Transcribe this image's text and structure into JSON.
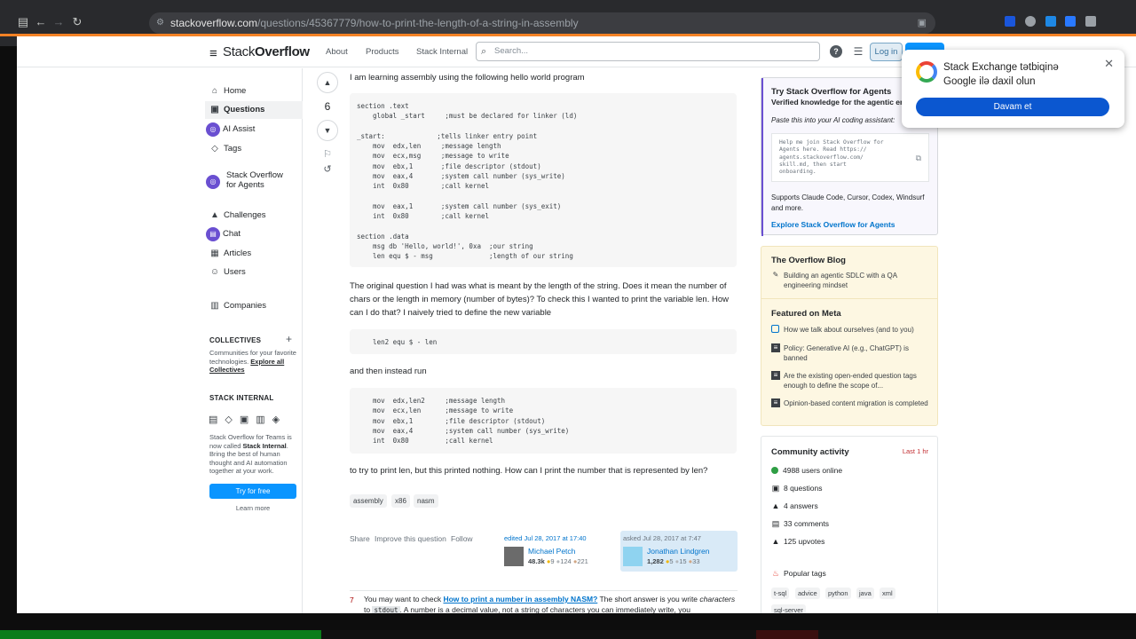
{
  "browser": {
    "url_host": "stackoverflow.com",
    "url_path": "/questions/45367779/how-to-print-the-length-of-a-string-in-assembly"
  },
  "header": {
    "logo_pre": "Stack",
    "logo_bold": "Overflow",
    "nav": [
      "About",
      "Products",
      "Stack Internal"
    ],
    "search_placeholder": "Search...",
    "login": "Log in"
  },
  "sidebar": {
    "items": [
      {
        "label": "Home",
        "icon": "home-icon"
      },
      {
        "label": "Questions",
        "icon": "questions-icon"
      },
      {
        "label": "AI Assist",
        "icon": "ai-assist-icon"
      },
      {
        "label": "Tags",
        "icon": "tag-icon"
      },
      {
        "label": "Stack Overflow for Agents",
        "icon": "agents-icon"
      },
      {
        "label": "Challenges",
        "icon": "challenges-icon"
      },
      {
        "label": "Chat",
        "icon": "chat-icon"
      },
      {
        "label": "Articles",
        "icon": "articles-icon"
      },
      {
        "label": "Users",
        "icon": "users-icon"
      },
      {
        "label": "Companies",
        "icon": "companies-icon"
      }
    ],
    "collectives_title": "COLLECTIVES",
    "collectives_text": "Communities for your favorite technologies.",
    "collectives_link": "Explore all Collectives",
    "internal_title": "STACK INTERNAL",
    "internal_pre": "Stack Overflow for Teams is now called",
    "internal_bold": "Stack Internal",
    "internal_post": ". Bring the best of human thought and AI automation together at your work.",
    "try_free": "Try for free",
    "learn_more": "Learn more"
  },
  "question": {
    "score": "6",
    "intro": "I am learning assembly using the following hello world program",
    "code1": "section .text\n    global _start     ;must be declared for linker (ld)\n\n_start:             ;tells linker entry point\n    mov  edx,len     ;message length\n    mov  ecx,msg     ;message to write\n    mov  ebx,1       ;file descriptor (stdout)\n    mov  eax,4       ;system call number (sys_write)\n    int  0x80        ;call kernel\n\n    mov  eax,1       ;system call number (sys_exit)\n    int  0x80        ;call kernel\n\nsection .data\n    msg db 'Hello, world!', 0xa  ;our string\n    len equ $ - msg              ;length of our string",
    "para2": "The original question I had was what is meant by the length of the string. Does it mean the number of chars or the length in memory (number of bytes)? To check this I wanted to print the variable len. How can I do that? I naively tried to define the new variable",
    "code2": "    len2 equ $ - len",
    "para3": "and then instead run",
    "code3": "    mov  edx,len2     ;message length\n    mov  ecx,len      ;message to write\n    mov  ebx,1        ;file descriptor (stdout)\n    mov  eax,4        ;system call number (sys_write)\n    int  0x80         ;call kernel",
    "para4": "to try to print len, but this printed nothing. How can I print the number that is represented by len?",
    "tags": [
      "assembly",
      "x86",
      "nasm"
    ],
    "actions": [
      "Share",
      "Improve this question",
      "Follow"
    ],
    "edited": {
      "ts": "edited Jul 28, 2017 at 17:40",
      "name": "Michael Petch",
      "rep": "48.3k",
      "gold": "9",
      "silver": "124",
      "bronze": "221"
    },
    "asked": {
      "ts": "asked Jul 28, 2017 at 7:47",
      "name": "Jonathan Lindgren",
      "rep": "1,282",
      "gold": "5",
      "silver": "15",
      "bronze": "33"
    }
  },
  "answer_preview": {
    "score": "7",
    "pre": "You may want to check ",
    "link": "How to print a number in assembly NASM?",
    "post1": " The short answer is you write ",
    "em": "characters",
    "post2": " to ",
    "code": "stdout",
    "post3": ". A number is a decimal value, not a string of characters you can immediately write, you"
  },
  "agents_box": {
    "title": "Try Stack Overflow for Agents",
    "subtitle": "Verified knowledge for the agentic era",
    "prompt": "Paste this into your AI coding assistant:",
    "snippet": "Help me join Stack Overflow for\nAgents here. Read https://\nagents.stackoverflow.com/\nskill.md, then start\nonboarding.",
    "supports": "Supports Claude Code, Cursor, Codex, Windsurf and more.",
    "link": "Explore Stack Overflow for Agents"
  },
  "blog": {
    "title": "The Overflow Blog",
    "items": [
      "Building an agentic SDLC with a QA engineering mindset"
    ],
    "meta_title": "Featured on Meta",
    "meta_items": [
      "How we talk about ourselves (and to you)",
      "Policy: Generative AI (e.g., ChatGPT) is banned",
      "Are the existing open-ended question tags enough to define the scope of...",
      "Opinion-based content migration is completed"
    ]
  },
  "community": {
    "title": "Community activity",
    "period": "Last 1 hr",
    "stats": [
      "4988 users online",
      "8 questions",
      "4 answers",
      "33 comments",
      "125 upvotes"
    ],
    "popular_title": "Popular tags",
    "popular": [
      "t-sql",
      "advice",
      "python",
      "java",
      "xml",
      "sql-server"
    ]
  },
  "popup": {
    "title": "Stack Exchange tətbiqinə Google ilə daxil olun",
    "button": "Davam et"
  },
  "colors": {
    "accent": "#f48225",
    "link": "#0074cc",
    "button": "#0a95ff",
    "google_button": "#0b57d0"
  }
}
